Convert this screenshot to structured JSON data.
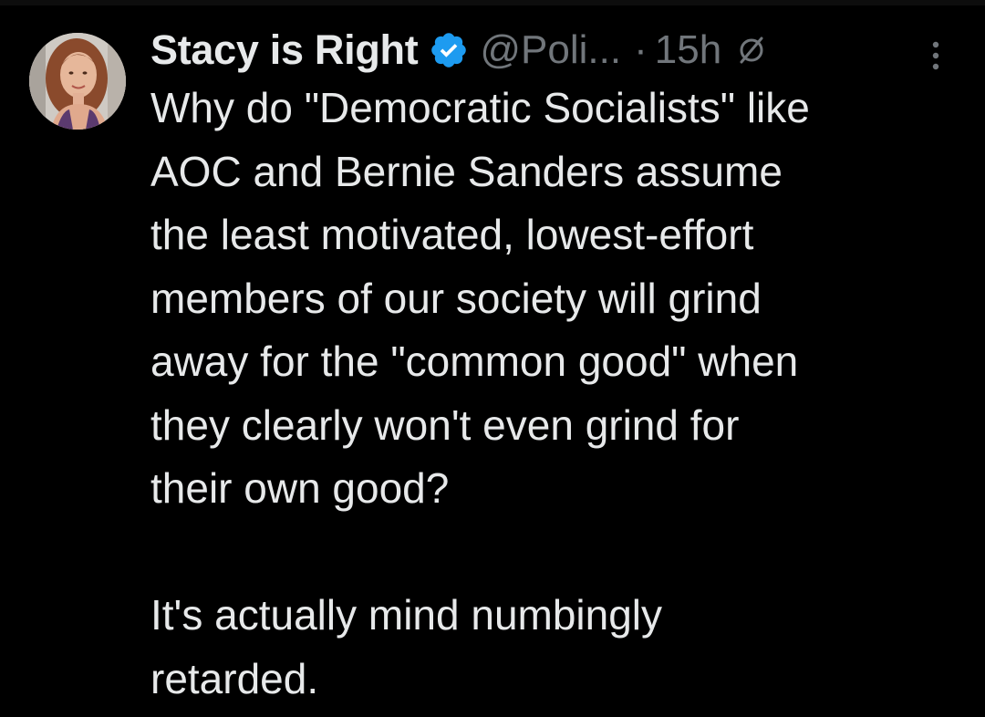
{
  "tweet": {
    "author": {
      "display_name": "Stacy is Right",
      "handle": "@Poli...",
      "verified": true
    },
    "separator": "·",
    "timestamp": "15h",
    "icons": {
      "verified": "verified-badge-icon",
      "edit": "edited-icon",
      "more": "more-vertical-icon",
      "avatar": "avatar"
    },
    "text": {
      "lines_p1": [
        "Why do \"Democratic Socialists\" like",
        "AOC and Bernie Sanders assume",
        "the least motivated, lowest-effort",
        "members of our society will grind",
        "away for the \"common good\" when",
        "they clearly won't even grind for",
        "their own good?"
      ],
      "lines_p2": [
        "It's actually mind numbingly",
        "retarded."
      ]
    },
    "colors": {
      "background": "#000000",
      "primary_text": "#e7e9ea",
      "secondary_text": "#71767b",
      "verified_blue": "#1d9bf0"
    }
  }
}
